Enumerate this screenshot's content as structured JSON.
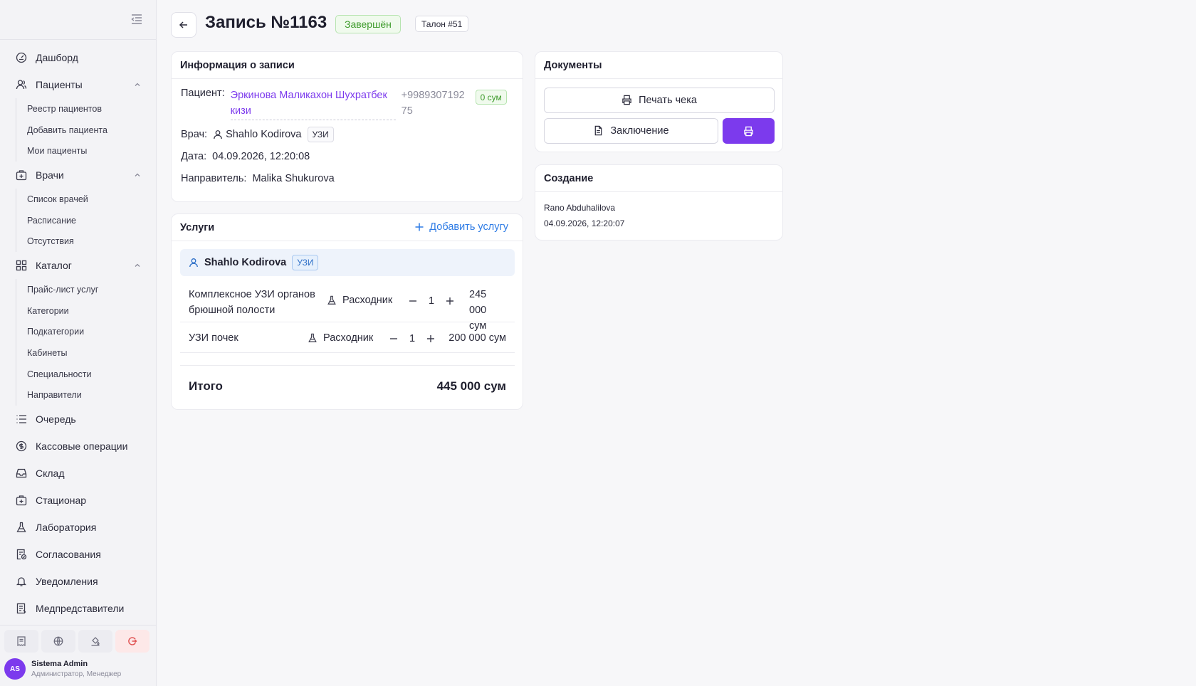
{
  "sidebar": {
    "items": {
      "dashboard": "Дашборд",
      "patients": "Пациенты",
      "patients_sub": [
        "Реестр пациентов",
        "Добавить пациента",
        "Мои пациенты"
      ],
      "doctors": "Врачи",
      "doctors_sub": [
        "Список врачей",
        "Расписание",
        "Отсутствия"
      ],
      "catalog": "Каталог",
      "catalog_sub": [
        "Прайс-лист услуг",
        "Категории",
        "Подкатегории",
        "Кабинеты",
        "Специальности",
        "Направители"
      ],
      "queue": "Очередь",
      "cash": "Кассовые операции",
      "warehouse": "Склад",
      "inpatient": "Стационар",
      "lab": "Лаборатория",
      "approvals": "Согласования",
      "notifications": "Уведомления",
      "reps": "Медпредставители"
    },
    "user": {
      "initials": "AS",
      "name": "Sistema Admin",
      "role": "Администратор, Менеджер"
    }
  },
  "header": {
    "title": "Запись №1163",
    "status": "Завершён",
    "ticket": "Талон #51"
  },
  "info": {
    "title": "Информация о записи",
    "patient_label": "Пациент:",
    "patient_name": "Эркинова Маликахон Шухратбек кизи",
    "patient_phone": "+998930719275",
    "patient_debt": "0 сум",
    "doctor_label": "Врач:",
    "doctor_name": "Shahlo Kodirova",
    "doctor_spec": "УЗИ",
    "date_label": "Дата:",
    "date_value": "04.09.2026, 12:20:08",
    "referrer_label": "Направитель:",
    "referrer_value": "Malika Shukurova"
  },
  "services": {
    "title": "Услуги",
    "add_label": "Добавить услугу",
    "group_doctor": "Shahlo Kodirova",
    "group_spec": "УЗИ",
    "rows": [
      {
        "name": "Комплексное УЗИ органов брюшной полости",
        "consumable": "Расходник",
        "qty": "1",
        "price": "245 000 сум"
      },
      {
        "name": "УЗИ почек",
        "consumable": "Расходник",
        "qty": "1",
        "price": "200 000 сум"
      }
    ],
    "total_label": "Итого",
    "total_value": "445 000 сум"
  },
  "documents": {
    "title": "Документы",
    "print_receipt": "Печать чека",
    "conclusion": "Заключение"
  },
  "creation": {
    "title": "Создание",
    "creator": "Rano Abduhalilova",
    "date": "04.09.2026, 12:20:07"
  },
  "colors": {
    "accent": "#7c3aed",
    "link": "#2d7be5",
    "success": "#3e9b2c"
  }
}
